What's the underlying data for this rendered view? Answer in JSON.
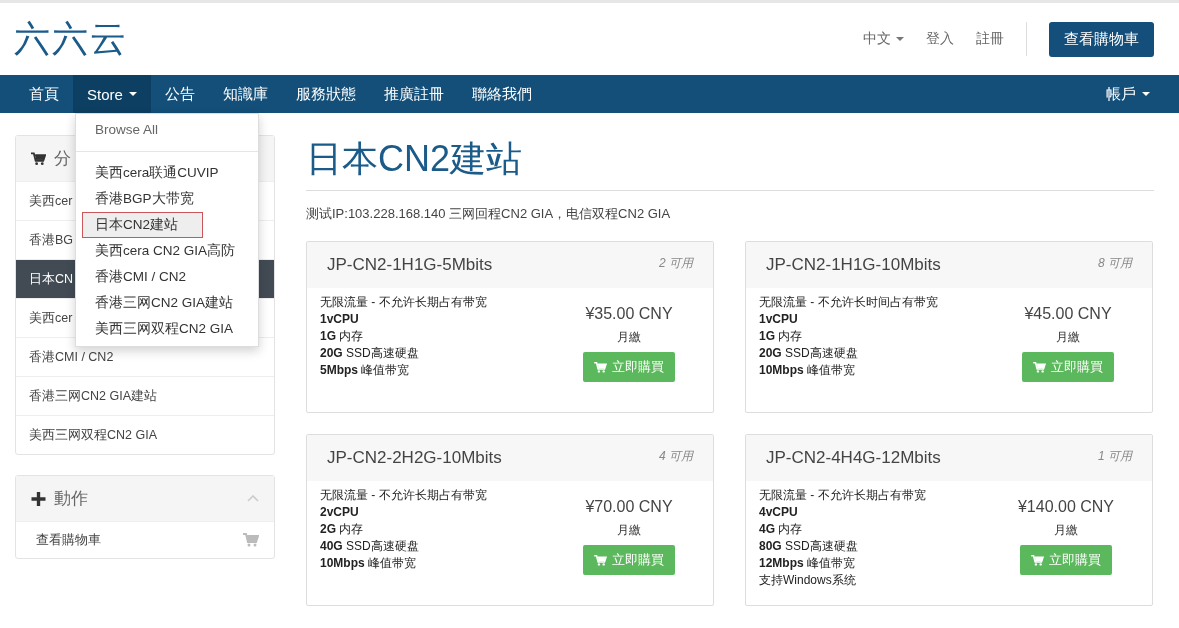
{
  "logo": "六六云",
  "top_links": [
    {
      "label": "中文",
      "kind": "dropdown"
    },
    {
      "label": "登入",
      "kind": "link"
    },
    {
      "label": "註冊",
      "kind": "link"
    }
  ],
  "cart_button": "查看購物車",
  "nav": [
    {
      "label": "首頁",
      "selected": false,
      "dropdown": false
    },
    {
      "label": "Store",
      "selected": true,
      "dropdown": true
    },
    {
      "label": "公告",
      "selected": false,
      "dropdown": false
    },
    {
      "label": "知識庫",
      "selected": false,
      "dropdown": false
    },
    {
      "label": "服務狀態",
      "selected": false,
      "dropdown": false
    },
    {
      "label": "推廣註冊",
      "selected": false,
      "dropdown": false
    },
    {
      "label": "聯絡我們",
      "selected": false,
      "dropdown": false
    }
  ],
  "account_menu": "帳戶",
  "store_menu": {
    "browse_all": "Browse All",
    "items": [
      {
        "label": "美西cera联通CUVIP",
        "selected": false
      },
      {
        "label": "香港BGP大带宽",
        "selected": false
      },
      {
        "label": "日本CN2建站",
        "selected": true
      },
      {
        "label": "美西cera CN2 GIA高防",
        "selected": false
      },
      {
        "label": "香港CMI / CN2",
        "selected": false
      },
      {
        "label": "香港三网CN2 GIA建站",
        "selected": false
      },
      {
        "label": "美西三网双程CN2 GIA",
        "selected": false
      }
    ]
  },
  "categories": {
    "title": "分",
    "items": [
      {
        "label": "美西cer",
        "selected": false
      },
      {
        "label": "香港BG",
        "selected": false
      },
      {
        "label": "日本CN",
        "selected": true
      },
      {
        "label": "美西cer",
        "selected": false
      },
      {
        "label": "香港CMI / CN2",
        "selected": false
      },
      {
        "label": "香港三网CN2 GIA建站",
        "selected": false
      },
      {
        "label": "美西三网双程CN2 GIA",
        "selected": false
      }
    ]
  },
  "actions": {
    "title": "動作",
    "items": [
      "查看購物車"
    ]
  },
  "page_title": "日本CN2建站",
  "description": "测试IP:103.228.168.140 三网回程CN2 GIA，电信双程CN2 GIA",
  "products": [
    {
      "name": "JP-CN2-1H1G-5Mbits",
      "available": "2 可用",
      "features": [
        "无限流量 - 不允许长期占有带宽",
        "**1vCPU**",
        "**1G** 内存",
        "**20G** SSD高速硬盘",
        "**5Mbps** 峰值带宽"
      ],
      "price": "¥35.00 CNY",
      "cycle": "月繳",
      "button": "立即購買"
    },
    {
      "name": "JP-CN2-1H1G-10Mbits",
      "available": "8 可用",
      "features": [
        "无限流量 - 不允许长时间占有带宽",
        "**1vCPU**",
        "**1G** 内存",
        "**20G** SSD高速硬盘",
        "**10Mbps** 峰值带宽"
      ],
      "price": "¥45.00 CNY",
      "cycle": "月繳",
      "button": "立即購買"
    },
    {
      "name": "JP-CN2-2H2G-10Mbits",
      "available": "4 可用",
      "features": [
        "无限流量 - 不允许长期占有带宽",
        "**2vCPU**",
        "**2G** 内存",
        "**40G** SSD高速硬盘",
        "**10Mbps** 峰值带宽"
      ],
      "price": "¥70.00 CNY",
      "cycle": "月繳",
      "button": "立即購買"
    },
    {
      "name": "JP-CN2-4H4G-12Mbits",
      "available": "1 可用",
      "features": [
        "无限流量 - 不允许长期占有带宽",
        "**4vCPU**",
        "**4G** 内存",
        "**80G** SSD高速硬盘",
        "**12Mbps** 峰值带宽",
        "支持Windows系统"
      ],
      "price": "¥140.00 CNY",
      "cycle": "月繳",
      "button": "立即購買"
    }
  ]
}
